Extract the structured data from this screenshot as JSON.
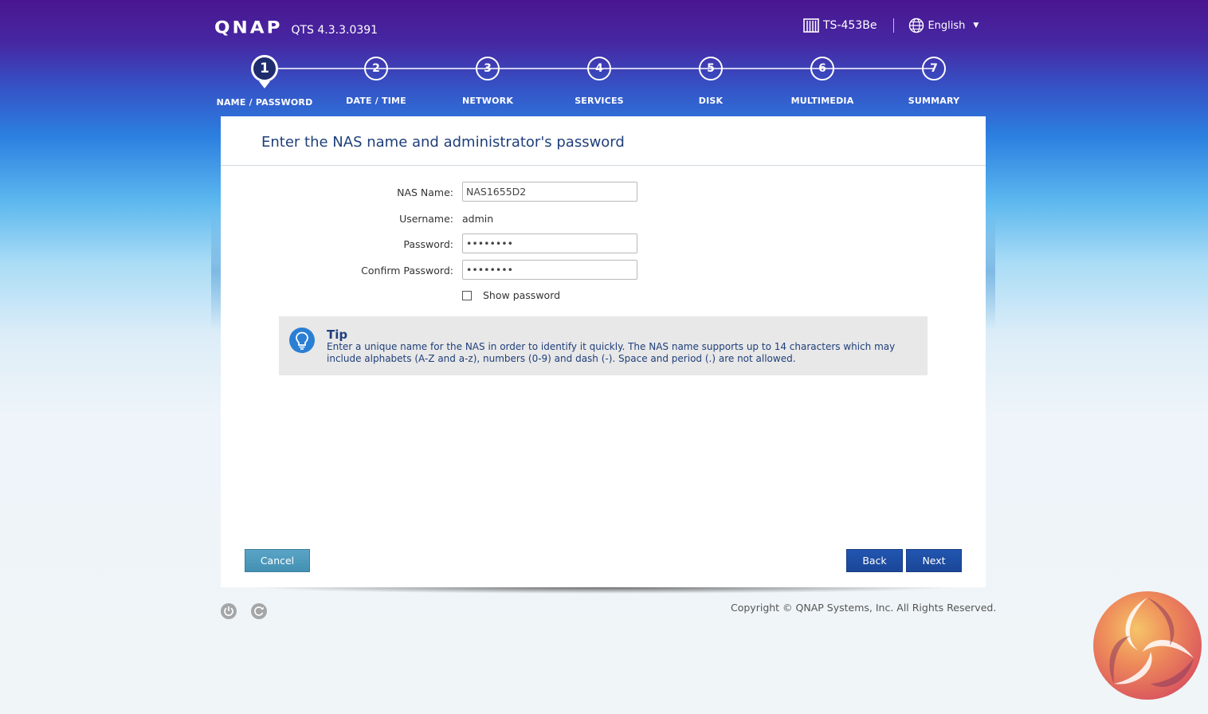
{
  "header": {
    "logo": "QNAP",
    "version": "QTS 4.3.3.0391",
    "model": "TS-453Be",
    "language": "English"
  },
  "steps": [
    {
      "num": "1",
      "label": "NAME / PASSWORD",
      "active": true
    },
    {
      "num": "2",
      "label": "DATE / TIME",
      "active": false
    },
    {
      "num": "3",
      "label": "NETWORK",
      "active": false
    },
    {
      "num": "4",
      "label": "SERVICES",
      "active": false
    },
    {
      "num": "5",
      "label": "DISK",
      "active": false
    },
    {
      "num": "6",
      "label": "MULTIMEDIA",
      "active": false
    },
    {
      "num": "7",
      "label": "SUMMARY",
      "active": false
    }
  ],
  "panel": {
    "title": "Enter the NAS name and administrator's password",
    "nas_name_label": "NAS Name:",
    "nas_name_value": "NAS1655D2",
    "username_label": "Username:",
    "username_value": "admin",
    "password_label": "Password:",
    "password_value": "••••••••",
    "confirm_label": "Confirm Password:",
    "confirm_value": "••••••••",
    "show_password_label": "Show password"
  },
  "tip": {
    "title": "Tip",
    "text": "Enter a unique name for the NAS in order to identify it quickly. The NAS name supports up to 14 characters which may include alphabets (A-Z and a-z), numbers (0-9) and dash (-). Space and period (.) are not allowed."
  },
  "buttons": {
    "cancel": "Cancel",
    "back": "Back",
    "next": "Next"
  },
  "footer": {
    "copyright": "Copyright © QNAP Systems, Inc. All Rights Reserved."
  },
  "colors": {
    "header_top": "#4a1690",
    "active_step": "#1f2c6e",
    "title_blue": "#1f3f7a",
    "button_blue": "#1b4698",
    "cancel_teal": "#4390b3"
  }
}
